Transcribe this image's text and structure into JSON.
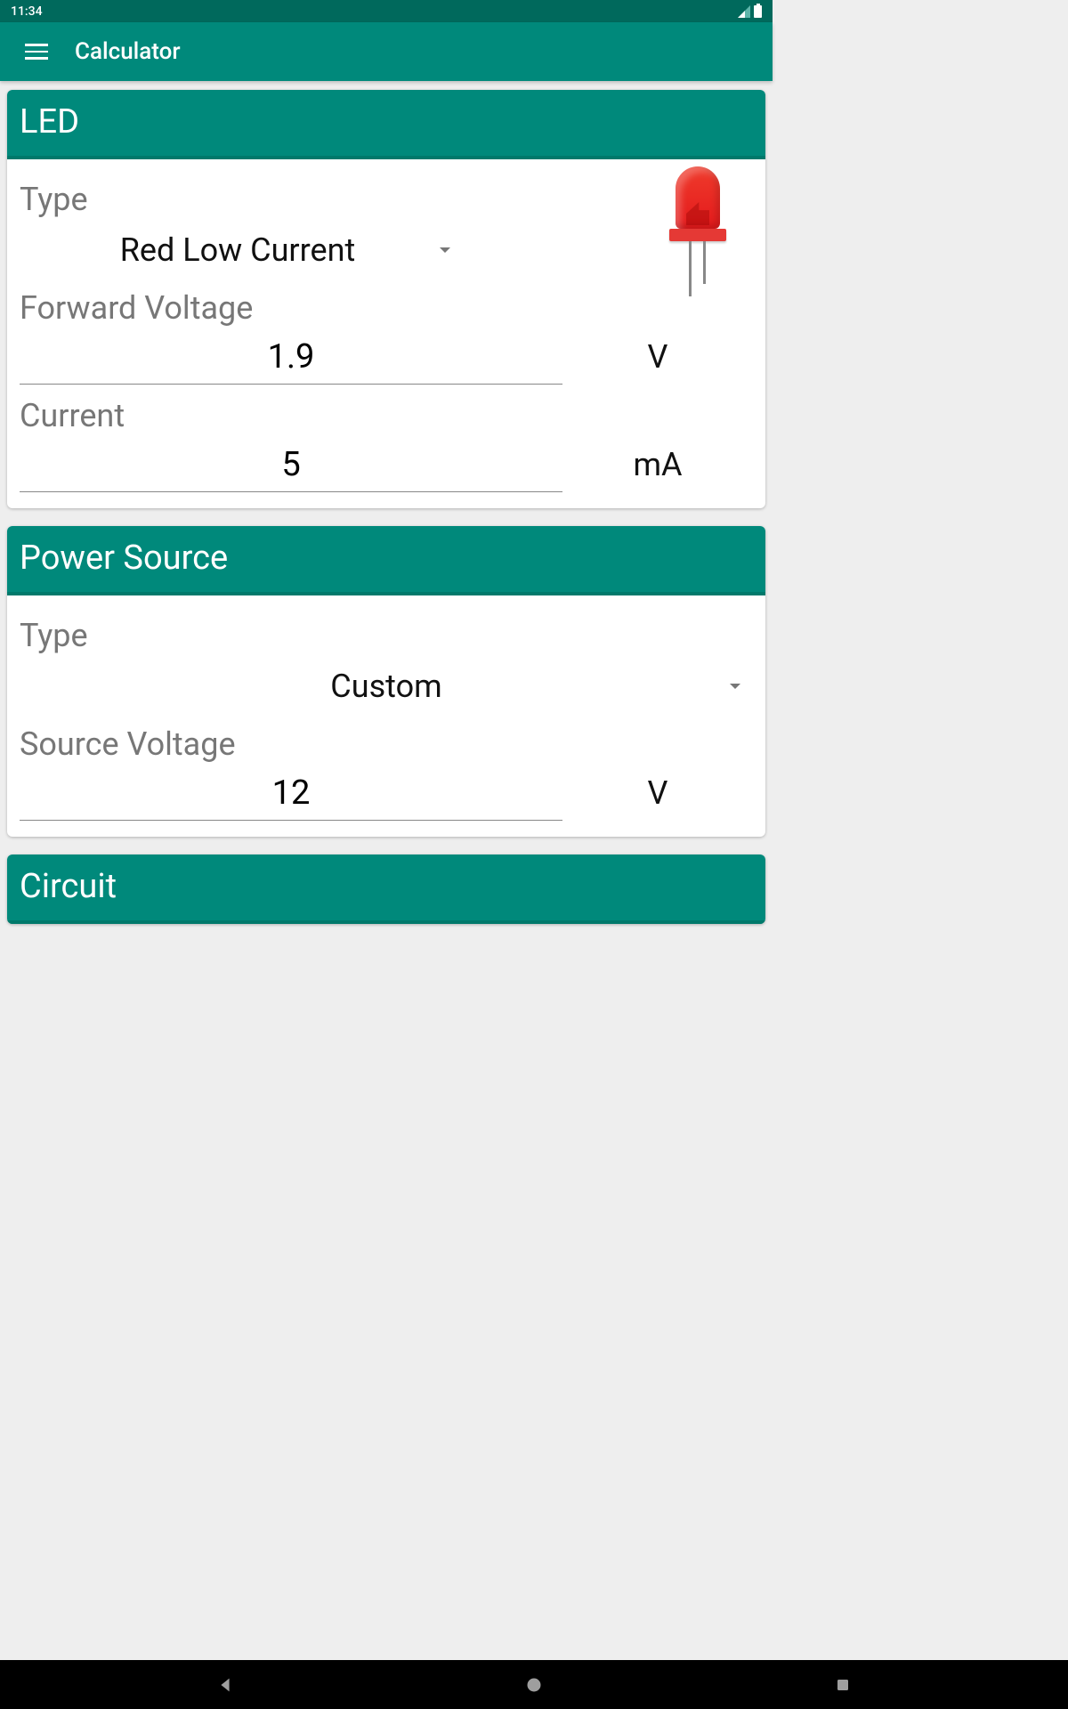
{
  "status": {
    "time": "11:34"
  },
  "appbar": {
    "title": "Calculator"
  },
  "led": {
    "header": "LED",
    "type_label": "Type",
    "type_value": "Red Low Current",
    "fv_label": "Forward Voltage",
    "fv_value": "1.9",
    "fv_unit": "V",
    "current_label": "Current",
    "current_value": "5",
    "current_unit": "mA"
  },
  "power": {
    "header": "Power Source",
    "type_label": "Type",
    "type_value": "Custom",
    "sv_label": "Source Voltage",
    "sv_value": "12",
    "sv_unit": "V"
  },
  "circuit": {
    "header": "Circuit"
  }
}
